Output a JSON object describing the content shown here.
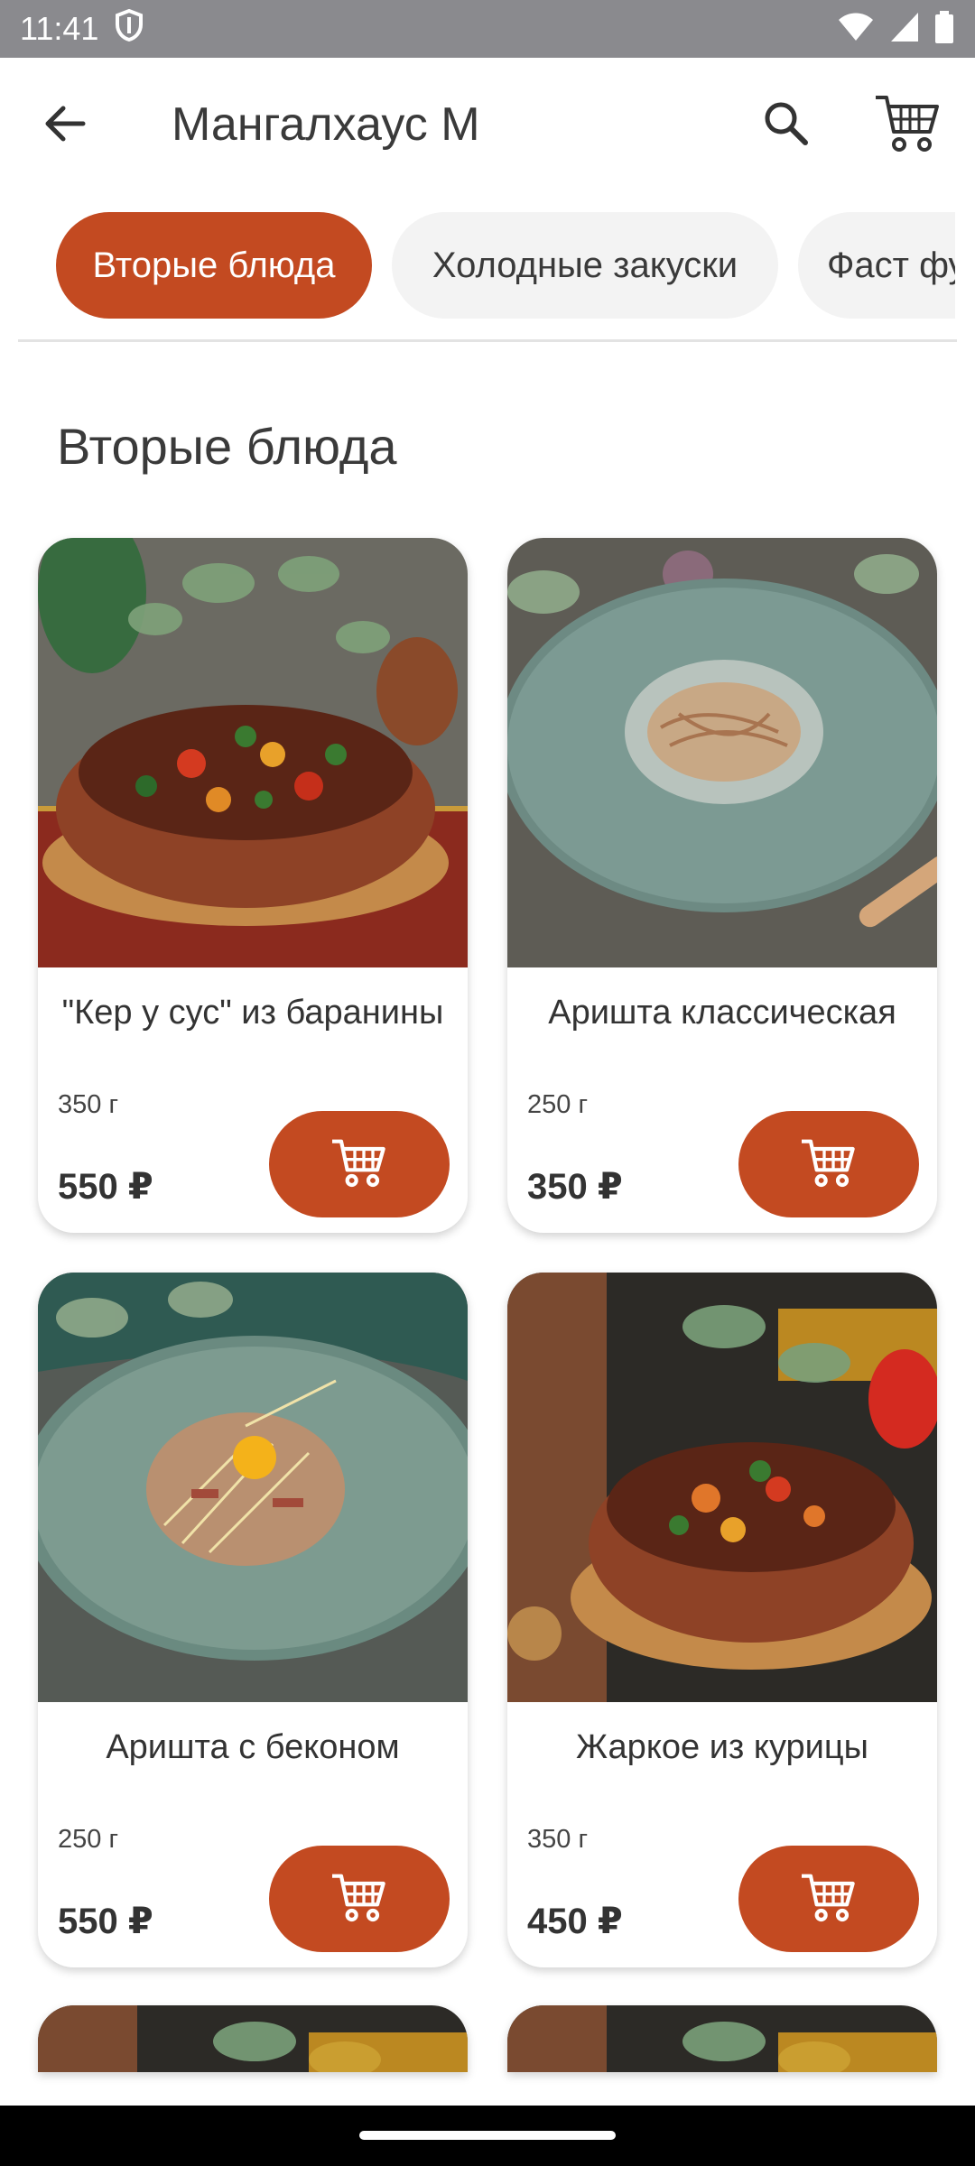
{
  "status_bar": {
    "time": "11:41",
    "icons": [
      "shield-icon",
      "wifi-icon",
      "signal-icon",
      "battery-icon"
    ]
  },
  "app_bar": {
    "title": "Мангалхаус М",
    "icons": [
      "back-arrow-icon",
      "search-icon",
      "cart-icon"
    ]
  },
  "tabs": [
    {
      "label": "Вторые блюда",
      "active": true
    },
    {
      "label": "Холодные закуски",
      "active": false
    },
    {
      "label": "Фаст фу",
      "active": false
    }
  ],
  "section": {
    "title": "Вторые блюда"
  },
  "products": [
    {
      "name": "\"Кер у сус\" из баранины",
      "weight": "350 г",
      "price": "550 ₽",
      "image": "clay-bowl-lamb-stew"
    },
    {
      "name": "Аришта классическая",
      "weight": "250 г",
      "price": "350 ₽",
      "image": "plate-noodles-creamy"
    },
    {
      "name": "Аришта с беконом",
      "weight": "250 г",
      "price": "550 ₽",
      "image": "plate-noodles-bacon-yolk"
    },
    {
      "name": "Жаркое из курицы",
      "weight": "350 г",
      "price": "450 ₽",
      "image": "clay-bowl-chicken-stew"
    }
  ],
  "colors": {
    "accent": "#c34a21",
    "status_bar": "#8a8a8e",
    "tab_inactive": "#f3f3f3"
  }
}
